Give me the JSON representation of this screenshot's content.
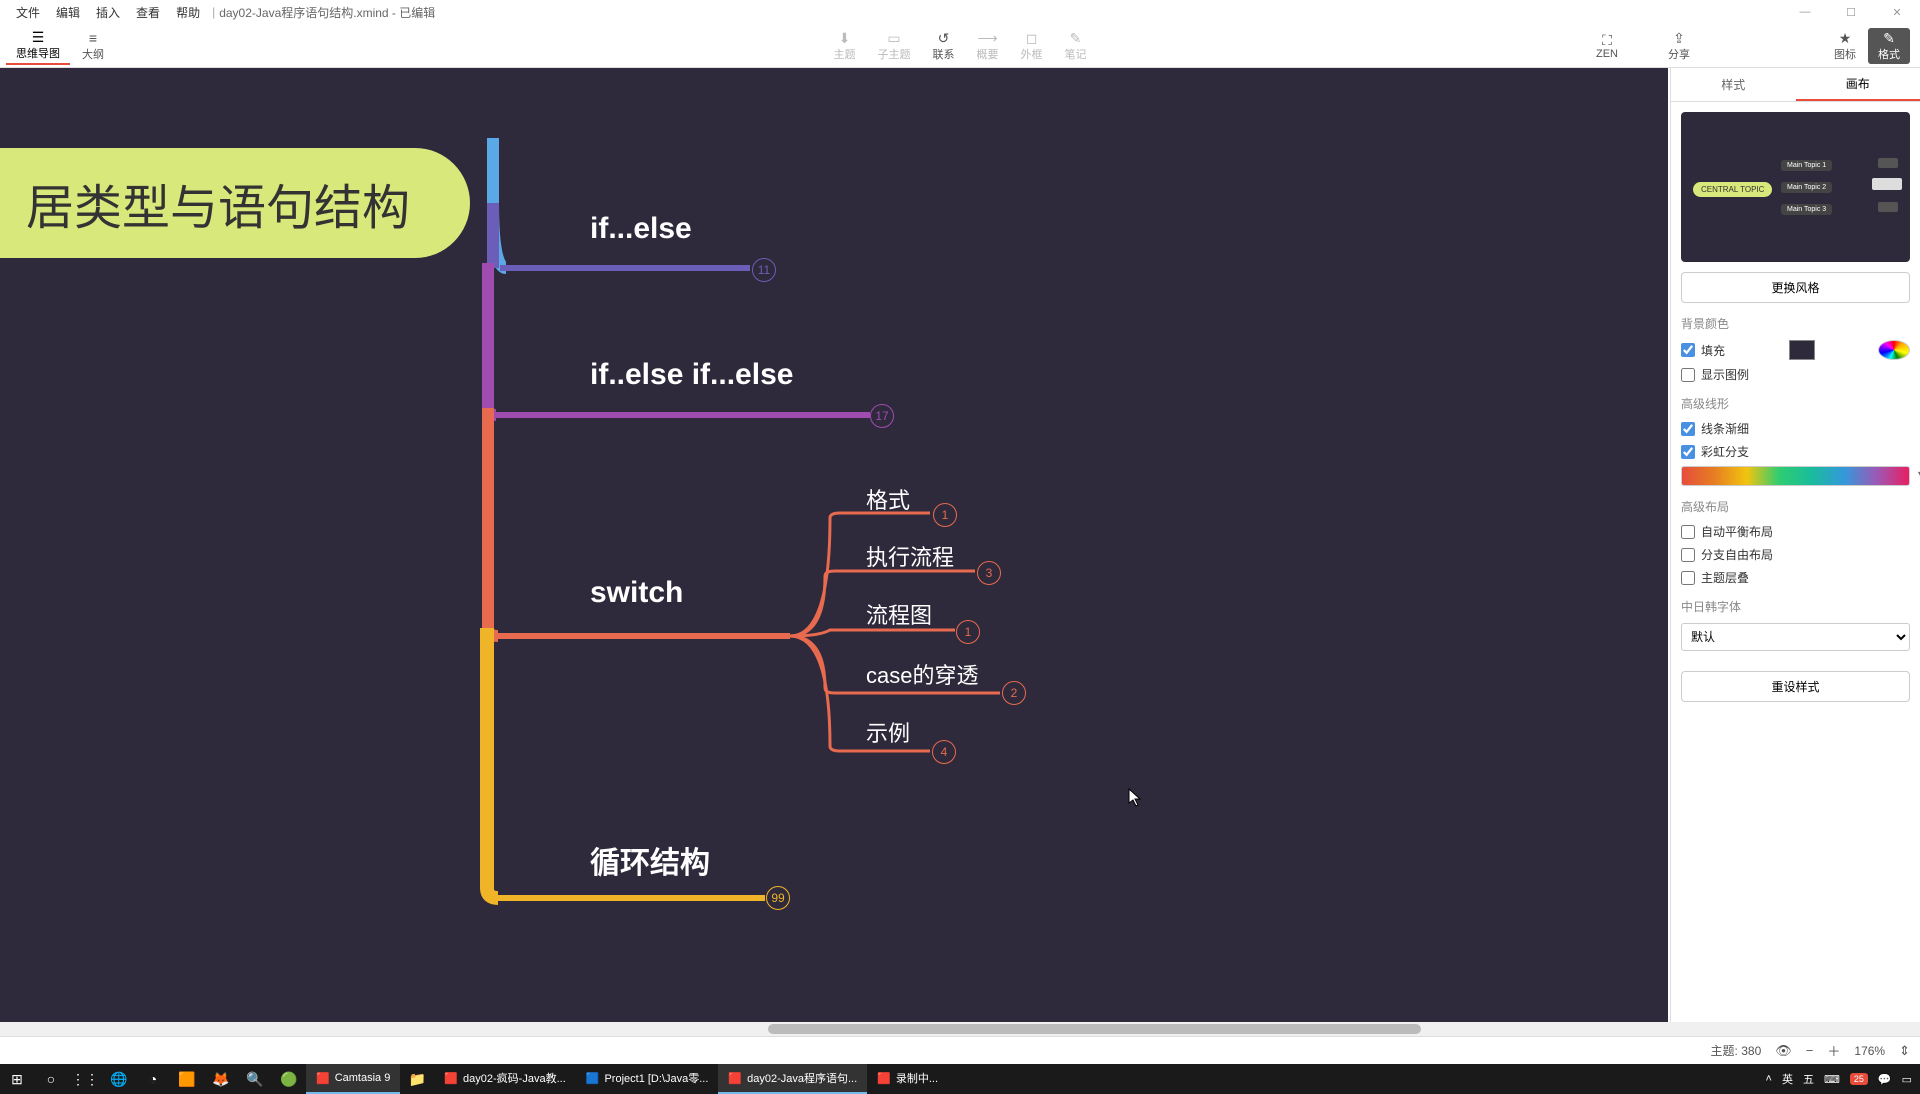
{
  "app": {
    "document_title": "day02-Java程序语句结构.xmind - 已编辑",
    "menus": [
      "文件",
      "编辑",
      "插入",
      "查看",
      "帮助"
    ]
  },
  "toolbar": {
    "left": [
      {
        "icon": "☰",
        "label": "思维导图",
        "active": true
      },
      {
        "icon": "≡",
        "label": "大纲",
        "active": false
      }
    ],
    "center": [
      {
        "icon": "⬇",
        "label": "主题"
      },
      {
        "icon": "▭",
        "label": "子主题"
      },
      {
        "icon": "↺",
        "label": "联系"
      },
      {
        "icon": "⟶",
        "label": "概要"
      },
      {
        "icon": "◻",
        "label": "外框"
      },
      {
        "icon": "✎",
        "label": "笔记"
      }
    ],
    "far": [
      {
        "icon": "⛶",
        "label": "ZEN"
      },
      {
        "icon": "⇪",
        "label": "分享"
      }
    ],
    "right": [
      {
        "icon": "★",
        "label": "图标"
      },
      {
        "icon": "✎",
        "label": "格式",
        "hl": true
      }
    ]
  },
  "mindmap": {
    "central": "居类型与语句结构",
    "branches": [
      {
        "label": "if...else",
        "count": 11,
        "color": "#6b5eb8"
      },
      {
        "label": "if..else if...else",
        "count": 17,
        "color": "#a04bb0"
      },
      {
        "label": "switch",
        "count": null,
        "color": "#e86a4f",
        "children": [
          {
            "label": "格式",
            "count": 1
          },
          {
            "label": "执行流程",
            "count": 3
          },
          {
            "label": "流程图",
            "count": 1
          },
          {
            "label": "case的穿透",
            "count": 2
          },
          {
            "label": "示例",
            "count": 4
          }
        ]
      },
      {
        "label": "循环结构",
        "count": 99,
        "color": "#f0b429"
      }
    ]
  },
  "side": {
    "tabs": [
      "样式",
      "画布"
    ],
    "active_tab": 1,
    "change_style": "更换风格",
    "bg_section": "背景颜色",
    "fill": "填充",
    "show_legend": "显示图例",
    "adv_line": "高级线形",
    "line_taper": "线条渐细",
    "rainbow_branch": "彩虹分支",
    "adv_layout": "高级布局",
    "auto_balance": "自动平衡布局",
    "free_branch": "分支自由布局",
    "topic_overlap": "主题层叠",
    "cjk_font": "中日韩字体",
    "font_default": "默认",
    "reset_style": "重设样式",
    "preview_central": "CENTRAL TOPIC",
    "preview_t1": "Main Topic 1",
    "preview_t2": "Main Topic 2",
    "preview_t3": "Main Topic 3"
  },
  "status": {
    "topic_label": "主题:",
    "topic_count": "380",
    "zoom": "176%"
  },
  "taskbar": {
    "apps": [
      {
        "icon": "📁",
        "label": ""
      },
      {
        "icon": "🟥",
        "label": "Camtasia 9"
      },
      {
        "icon": "🟥",
        "label": "day02-疯码-Java教..."
      },
      {
        "icon": "🟦",
        "label": "Project1 [D:\\Java零..."
      },
      {
        "icon": "🟥",
        "label": "day02-Java程序语句..."
      },
      {
        "icon": "🟥",
        "label": "录制中..."
      }
    ],
    "tray_lang": "英",
    "tray_ime": "五",
    "notif_count": "25"
  }
}
